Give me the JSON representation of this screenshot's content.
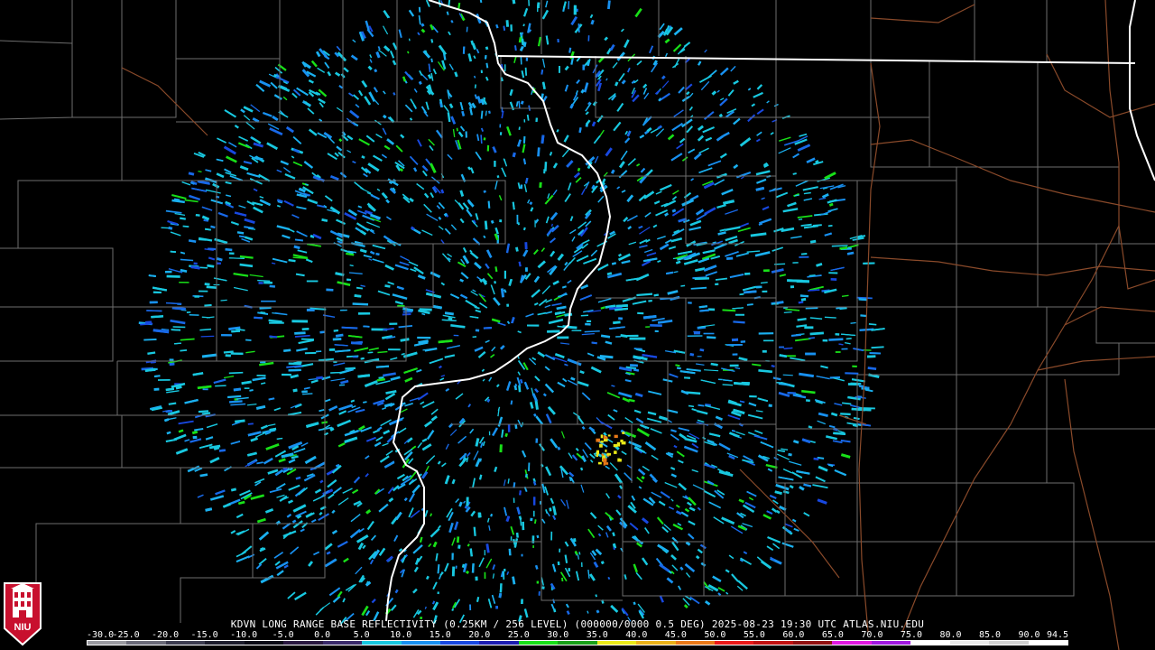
{
  "product": {
    "title": "KDVN LONG RANGE BASE REFLECTIVITY (0.25KM / 256 LEVEL) (000000/0000 0.5 DEG) 2025-08-23 19:30 UTC  ATLAS.NIU.EDU"
  },
  "legend": {
    "labels": [
      "-30.0",
      "-25.0",
      "-20.0",
      "-15.0",
      "-10.0",
      "-5.0",
      "0.0",
      "5.0",
      "10.0",
      "15.0",
      "20.0",
      "25.0",
      "30.0",
      "35.0",
      "40.0",
      "45.0",
      "50.0",
      "55.0",
      "60.0",
      "65.0",
      "70.0",
      "75.0",
      "80.0",
      "85.0",
      "90.0",
      "94.5"
    ],
    "colors": [
      "#9a9aa0",
      "#6a6a78",
      "#3c3c50",
      "#1c1c2c",
      "#0a0a14",
      "#2a1840",
      "#3a2a6a",
      "#18c8e0",
      "#1890f0",
      "#1848e0",
      "#1c1cb0",
      "#18e018",
      "#18a018",
      "#e8e818",
      "#e8b018",
      "#e87818",
      "#e81818",
      "#c01010",
      "#901010",
      "#e018e0",
      "#a018e0",
      "#ffffff",
      "#e8e8e8",
      "#d0d0d0",
      "#ffffff"
    ]
  },
  "logo": {
    "text": "NIU"
  },
  "map_style": {
    "county_color": "#6e6e6e",
    "road_color": "#8a4a2a",
    "state_border_color": "#ffffff",
    "echo_palette": [
      "#18c8e0",
      "#1ab0f0",
      "#1890f0",
      "#1868e8",
      "#1848e0",
      "#18e018",
      "#e8e818",
      "#e87818"
    ]
  }
}
